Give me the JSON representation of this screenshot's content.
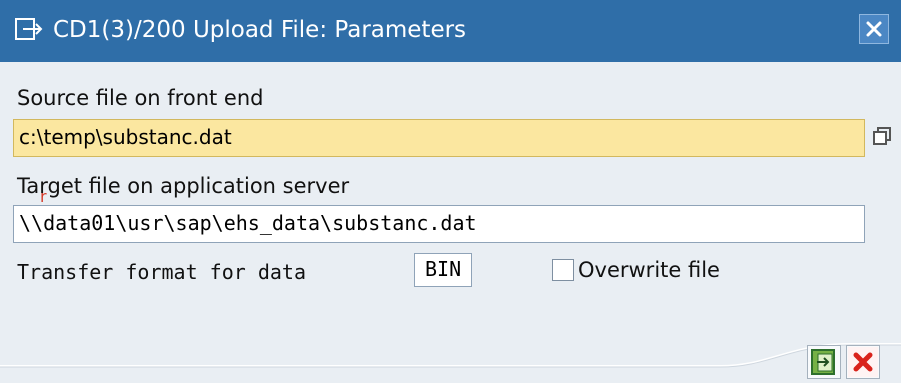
{
  "window": {
    "title": "CD1(3)/200 Upload File: Parameters",
    "close_icon": "close-icon"
  },
  "form": {
    "source_label": "Source file on front end",
    "source_value": "c:\\temp\\substanc.dat",
    "target_label": "Target file on application server",
    "target_value": "\\\\data01\\usr\\sap\\ehs_data\\substanc.dat",
    "transfer_label": "Transfer format for data",
    "transfer_value": "BIN",
    "overwrite_label": "Overwrite file"
  },
  "icons": {
    "title_icon": "dialog-icon",
    "source_side_icon": "copy-icon",
    "ok_icon": "continue-icon",
    "cancel_icon": "cancel-icon"
  },
  "colors": {
    "title_bar": "#2f6ea8",
    "active_field": "#fbe7a0",
    "background": "#e9eef3"
  }
}
